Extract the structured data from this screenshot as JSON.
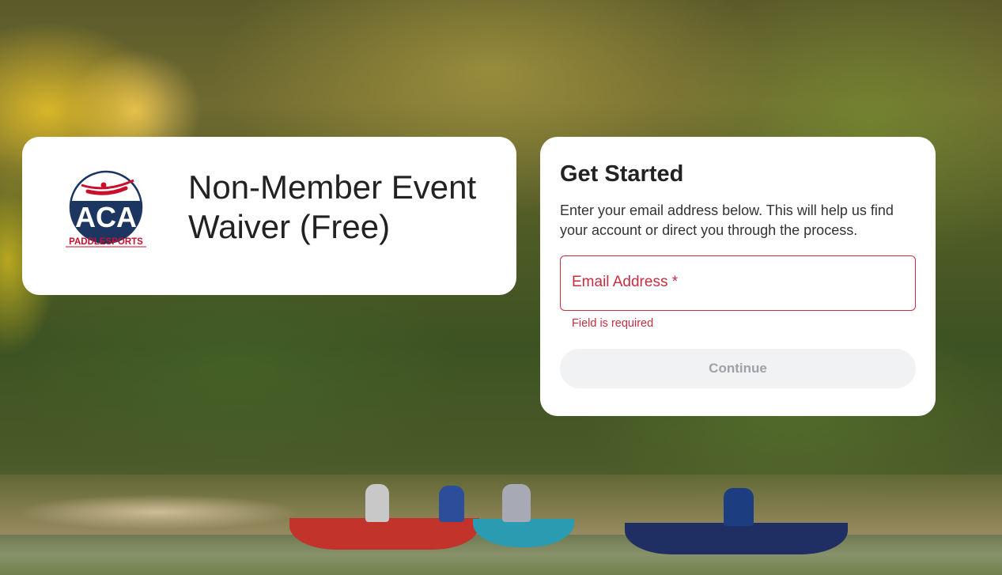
{
  "brand": {
    "logo_text": "ACA",
    "logo_subtext": "PADDLESPORTS",
    "title_line1": "Non-Member Event",
    "title_line2": "Waiver (Free)"
  },
  "form": {
    "heading": "Get Started",
    "description": "Enter your email address below. This will help us find your account or direct you through the process.",
    "email_label": "Email Address *",
    "email_value": "",
    "error_text": "Field is required",
    "continue_label": "Continue"
  },
  "colors": {
    "error": "#c62e3f",
    "logo_navy": "#1c3561",
    "logo_red": "#c8102e",
    "button_bg": "#f1f2f4",
    "button_text": "#9ea2a8"
  }
}
